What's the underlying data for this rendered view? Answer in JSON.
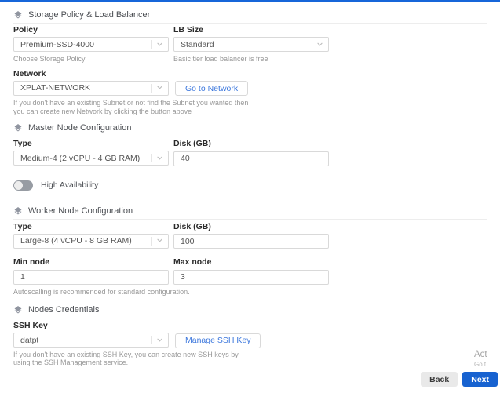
{
  "colors": {
    "topbar_blue": "#1766d9",
    "accent_blue": "#1762d0",
    "link_blue": "#3d78dd"
  },
  "storage_section": {
    "title": "Storage Policy & Load Balancer",
    "policy": {
      "label": "Policy",
      "value": "Premium-SSD-4000",
      "helper": "Choose Storage Policy"
    },
    "lb_size": {
      "label": "LB Size",
      "value": "Standard",
      "helper": "Basic tier load balancer is free"
    },
    "network": {
      "label": "Network",
      "value": "XPLAT-NETWORK",
      "button_label": "Go to Network",
      "helper": "If you don't have an existing Subnet or not find the Subnet you wanted then you can create new Network by clicking the button above"
    }
  },
  "master_section": {
    "title": "Master Node Configuration",
    "type": {
      "label": "Type",
      "value": "Medium-4 (2 vCPU - 4 GB RAM)"
    },
    "disk": {
      "label": "Disk (GB)",
      "value": "40"
    },
    "high_availability": {
      "label": "High Availability",
      "state": "off"
    }
  },
  "worker_section": {
    "title": "Worker Node Configuration",
    "type": {
      "label": "Type",
      "value": "Large-8 (4 vCPU - 8 GB RAM)"
    },
    "disk": {
      "label": "Disk (GB)",
      "value": "100"
    },
    "min_node": {
      "label": "Min node",
      "value": "1"
    },
    "max_node": {
      "label": "Max node",
      "value": "3"
    },
    "helper": "Autoscalling is recommended for standard configuration."
  },
  "credentials_section": {
    "title": "Nodes Credentials",
    "ssh_key": {
      "label": "SSH Key",
      "value": "datpt",
      "button_label": "Manage SSH Key",
      "helper": "If you don't have an existing SSH Key, you can create new SSH keys by using the SSH Management service."
    }
  },
  "footer": {
    "back_label": "Back",
    "next_label": "Next"
  },
  "watermark": {
    "line1": "Act",
    "line2": "Go t"
  }
}
